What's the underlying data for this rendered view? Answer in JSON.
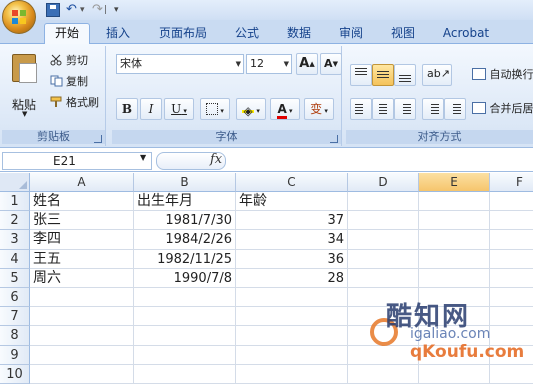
{
  "quick_access": {
    "undo": "↶",
    "redo": "↷",
    "more": "▾"
  },
  "tabs": [
    {
      "label": "开始",
      "active": true
    },
    {
      "label": "插入"
    },
    {
      "label": "页面布局"
    },
    {
      "label": "公式"
    },
    {
      "label": "数据"
    },
    {
      "label": "审阅"
    },
    {
      "label": "视图"
    },
    {
      "label": "Acrobat"
    }
  ],
  "clipboard": {
    "paste": "粘贴",
    "cut": "剪切",
    "copy": "复制",
    "format_painter": "格式刷",
    "group_label": "剪贴板"
  },
  "font": {
    "name": "宋体",
    "size": "12",
    "grow": "A",
    "shrink": "A",
    "bold": "B",
    "italic": "I",
    "underline": "U",
    "font_color": "A",
    "phonetic": "变",
    "group_label": "字体"
  },
  "alignment": {
    "wrap_text": "自动换行",
    "merge_center": "合并后居中",
    "group_label": "对齐方式"
  },
  "formula_bar": {
    "name_box": "E21",
    "fx": "fx",
    "formula": ""
  },
  "grid": {
    "columns": [
      "A",
      "B",
      "C",
      "D",
      "E",
      "F"
    ],
    "selected_column": "E",
    "rows": [
      "1",
      "2",
      "3",
      "4",
      "5",
      "6",
      "7",
      "8",
      "9",
      "10"
    ],
    "cells": [
      [
        "姓名",
        "出生年月",
        "年龄"
      ],
      [
        "张三",
        "1981/7/30",
        "37"
      ],
      [
        "李四",
        "1984/2/26",
        "34"
      ],
      [
        "王五",
        "1982/11/25",
        "36"
      ],
      [
        "周六",
        "1990/7/8",
        "28"
      ]
    ]
  },
  "watermark": {
    "top": "酷知网",
    "url": "igaliao.com",
    "bottom": "qKoufu.com"
  },
  "colors": {
    "ribbon_bg": "#dfe9f7",
    "tab_text": "#15428b",
    "selected_header": "#f6c56c"
  }
}
